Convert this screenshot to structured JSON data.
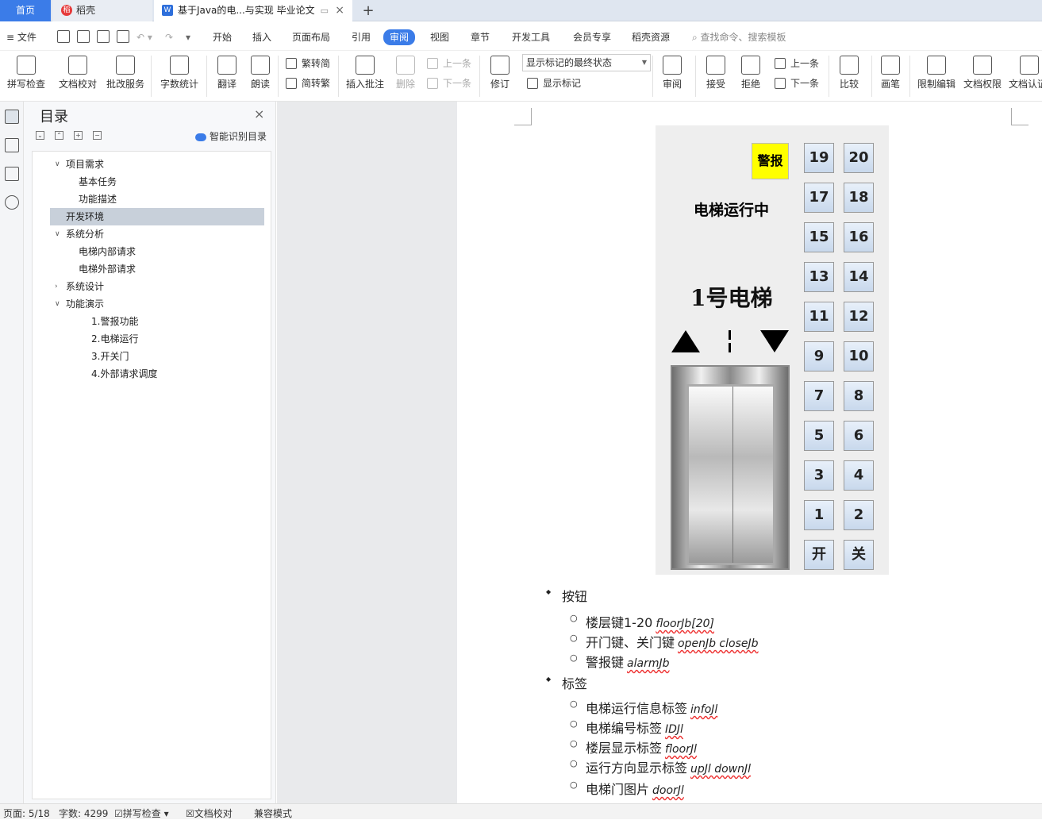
{
  "tabs": {
    "home": "首页",
    "docer": "稻壳",
    "doc": "基于Java的电...与实现 毕业论文"
  },
  "menu": {
    "file": "文件",
    "items": [
      "开始",
      "插入",
      "页面布局",
      "引用",
      "审阅",
      "视图",
      "章节",
      "开发工具",
      "会员专享",
      "稻壳资源"
    ],
    "active": "审阅",
    "search": "查找命令、搜索模板"
  },
  "ribbon": {
    "spell": "拼写检查",
    "proof": "文档校对",
    "correct": "批改服务",
    "wordcount": "字数统计",
    "translate": "翻译",
    "read": "朗读",
    "to_trad": "繁转简",
    "to_simp": "简转繁",
    "insert_comment": "插入批注",
    "delete": "删除",
    "prev": "上一条",
    "next": "下一条",
    "revise": "修订",
    "track_state": "显示标记的最终状态",
    "show_marks": "显示标记",
    "review": "审阅",
    "accept": "接受",
    "reject": "拒绝",
    "prev2": "上一条",
    "next2": "下一条",
    "compare": "比较",
    "pen": "画笔",
    "restrict": "限制编辑",
    "perm": "文档权限",
    "cert": "文档认证"
  },
  "nav": {
    "title": "目录",
    "smart": "智能识别目录",
    "toc": [
      {
        "label": "项目需求",
        "level": 1,
        "expanded": true
      },
      {
        "label": "基本任务",
        "level": 2
      },
      {
        "label": "功能描述",
        "level": 2
      },
      {
        "label": "开发环境",
        "level": 1,
        "selected": true
      },
      {
        "label": "系统分析",
        "level": 1,
        "expanded": true
      },
      {
        "label": "电梯内部请求",
        "level": 2
      },
      {
        "label": "电梯外部请求",
        "level": 2
      },
      {
        "label": "系统设计",
        "level": 1,
        "expanded": false
      },
      {
        "label": "功能演示",
        "level": 1,
        "expanded": true
      },
      {
        "label": "1.警报功能",
        "level": 3
      },
      {
        "label": "2.电梯运行",
        "level": 3
      },
      {
        "label": "3.开关门",
        "level": 3
      },
      {
        "label": "4.外部请求调度",
        "level": 3
      }
    ]
  },
  "elevator": {
    "alarm": "警报",
    "status": "电梯运行中",
    "name": "1号电梯",
    "buttons": [
      [
        "19",
        "20"
      ],
      [
        "17",
        "18"
      ],
      [
        "15",
        "16"
      ],
      [
        "13",
        "14"
      ],
      [
        "11",
        "12"
      ],
      [
        "9",
        "10"
      ],
      [
        "7",
        "8"
      ],
      [
        "5",
        "6"
      ],
      [
        "3",
        "4"
      ],
      [
        "1",
        "2"
      ],
      [
        "开",
        "关"
      ]
    ]
  },
  "content": {
    "b1": "按钮",
    "b1a": "楼层键1-20",
    "b1a_code": "floorJb[20]",
    "b1b": "开门键、关门键",
    "b1b_code": "openJb closeJb",
    "b1c": "警报键",
    "b1c_code": "alarmJb",
    "b2": "标签",
    "b2a": "电梯运行信息标签",
    "b2a_code": "infoJl",
    "b2b": "电梯编号标签",
    "b2b_code": "IDJl",
    "b2c": "楼层显示标签",
    "b2c_code": "floorJl",
    "b2d": "运行方向显示标签",
    "b2d_code": "upJl downJl",
    "b2e": "电梯门图片",
    "b2e_code": "doorJl"
  },
  "status": {
    "page": "页面: 5/18",
    "words": "字数: 4299",
    "spell": "拼写检查",
    "proof": "文档校对",
    "compat": "兼容模式"
  },
  "colors": {
    "accent": "#3b7ce8",
    "alarm": "#ffff00"
  }
}
